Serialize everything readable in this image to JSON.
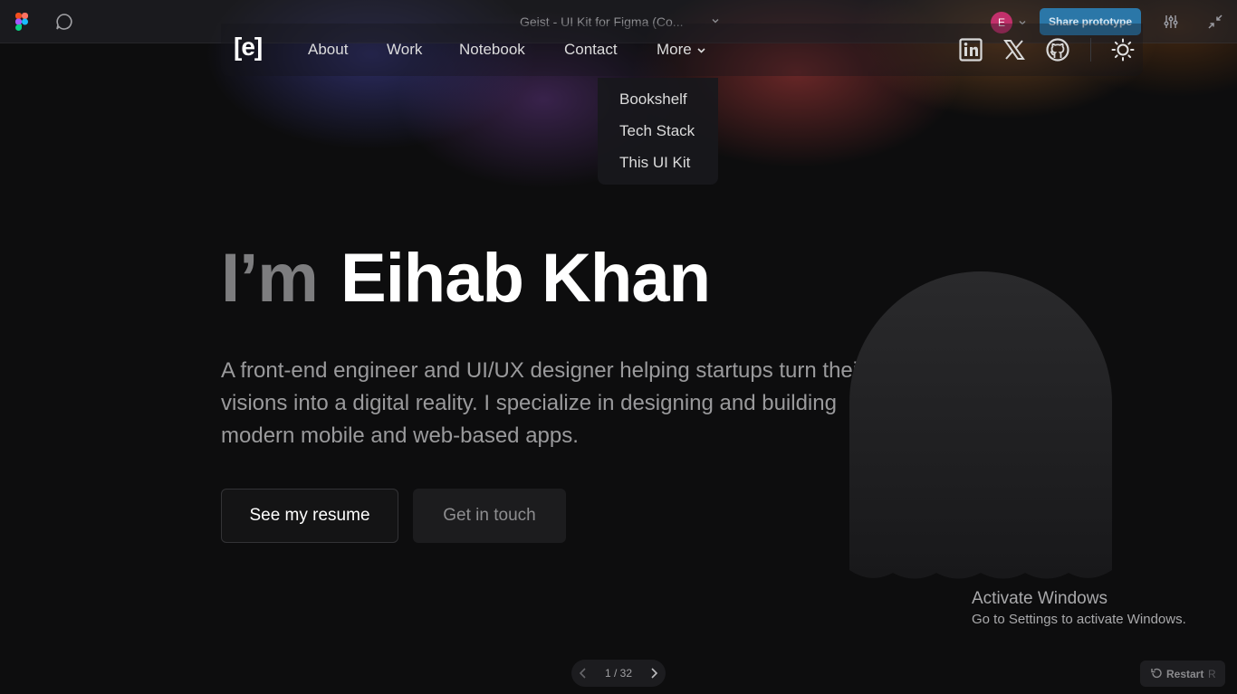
{
  "figma": {
    "file_title": "Geist - UI Kit for Figma (Co...",
    "avatar_initial": "E",
    "share_label": "Share prototype",
    "brand_color": "#2b77a8",
    "avatar_color": "#c2306b"
  },
  "nav": {
    "logo": "[e]",
    "links": [
      "About",
      "Work",
      "Notebook",
      "Contact",
      "More"
    ],
    "social_icons": [
      "linkedin-icon",
      "x-icon",
      "github-icon"
    ],
    "theme_icon": "sun-icon"
  },
  "dropdown": {
    "items": [
      "Bookshelf",
      "Tech Stack",
      "This UI Kit"
    ]
  },
  "hero": {
    "greeting": "I’m",
    "name": "Eihab Khan",
    "description": "A front-end engineer and UI/UX designer helping startups turn their visions into a digital reality. I specialize in designing and building modern mobile and web-based apps.",
    "primary_button": "See my resume",
    "secondary_button": "Get in touch"
  },
  "watermark": {
    "title": "Activate Windows",
    "subtitle": "Go to Settings to activate Windows."
  },
  "presentation": {
    "pager": "1 / 32",
    "restart_label": "Restart",
    "restart_key": "R"
  }
}
